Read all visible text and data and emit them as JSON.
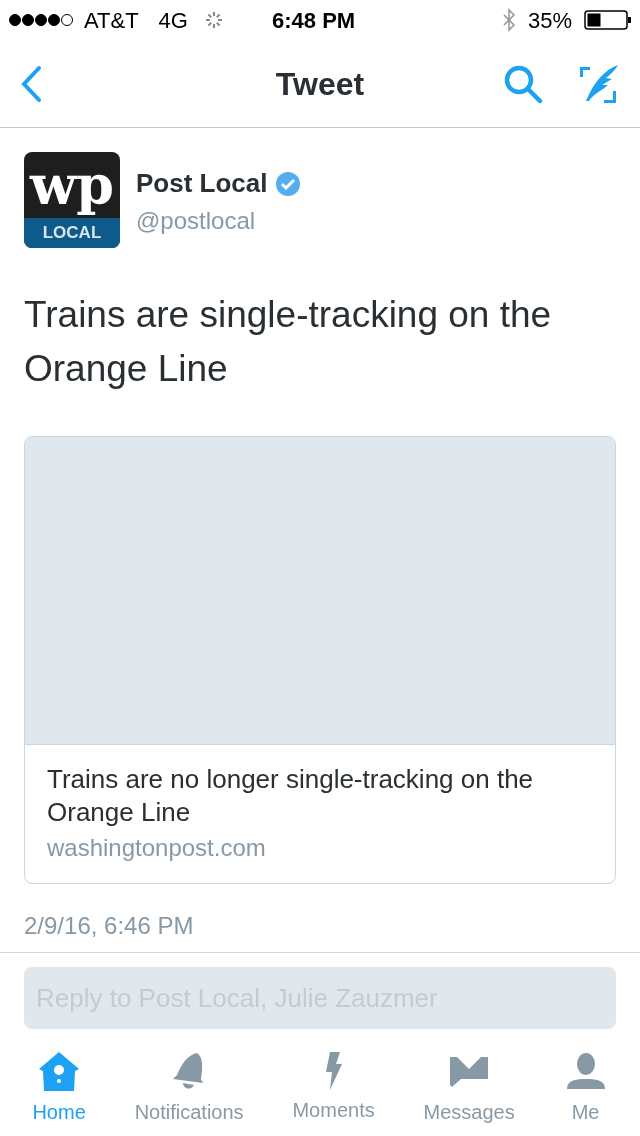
{
  "status_bar": {
    "carrier": "AT&T",
    "network": "4G",
    "time": "6:48 PM",
    "battery": "35%"
  },
  "nav": {
    "title": "Tweet"
  },
  "tweet": {
    "avatar": {
      "monogram": "wp",
      "label": "LOCAL"
    },
    "name": "Post Local",
    "verified": true,
    "handle": "@postlocal",
    "text": "Trains are single-tracking on the Orange Line",
    "card": {
      "title": "Trains are no longer single-tracking on the Orange Line",
      "domain": "washingtonpost.com"
    },
    "timestamp": "2/9/16, 6:46 PM"
  },
  "reply": {
    "placeholder": "Reply to Post Local, Julie Zauzmer"
  },
  "tabs": [
    {
      "kind": "home",
      "label": "Home",
      "selected": true
    },
    {
      "kind": "bell",
      "label": "Notifications",
      "selected": false
    },
    {
      "kind": "bolt",
      "label": "Moments",
      "selected": false
    },
    {
      "kind": "mail",
      "label": "Messages",
      "selected": false
    },
    {
      "kind": "person",
      "label": "Me",
      "selected": false
    }
  ]
}
